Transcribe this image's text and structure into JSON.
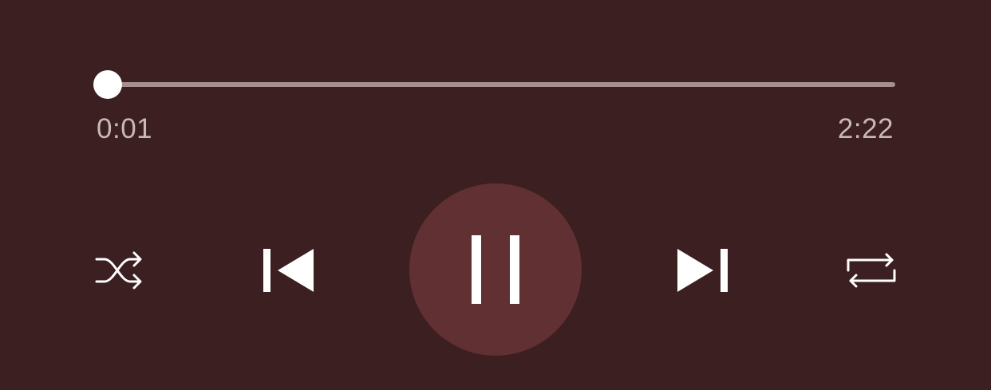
{
  "player": {
    "elapsed": "0:01",
    "duration": "2:22",
    "progress_fraction": 0.007,
    "is_playing": true
  },
  "controls": {
    "shuffle_icon": "shuffle-icon",
    "previous_icon": "skip-previous-icon",
    "play_pause_icon": "pause-icon",
    "next_icon": "skip-next-icon",
    "repeat_icon": "repeat-icon"
  },
  "colors": {
    "background": "#3c1f21",
    "track": "#a58f90",
    "thumb": "#ffffff",
    "time_text": "#c9b8b8",
    "play_button_bg": "#603032",
    "icon": "#ffffff"
  }
}
